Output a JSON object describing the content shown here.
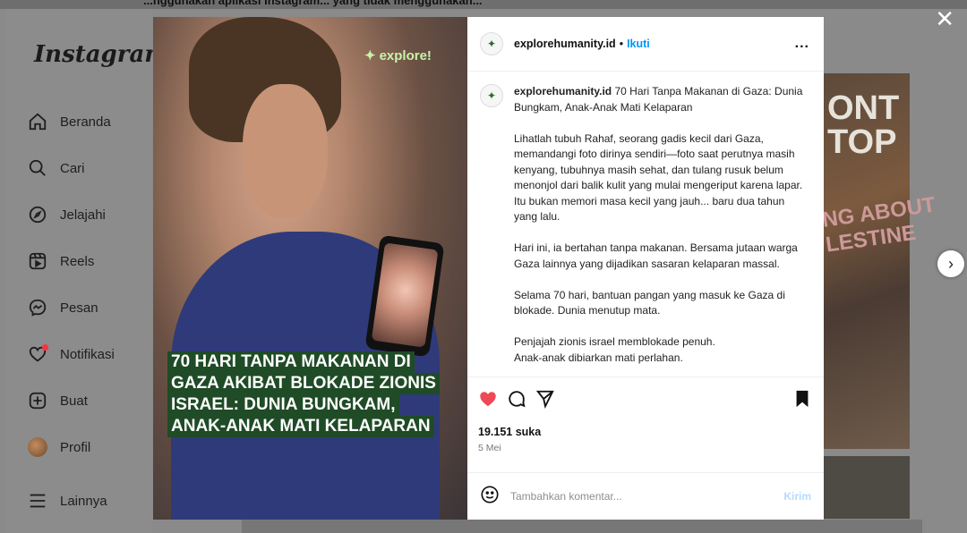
{
  "top_strip_text": "...nggunakan aplikasi Instagram... yang tidak menggunakan...",
  "sidebar": {
    "logo": "Instagram",
    "items": [
      {
        "label": "Beranda",
        "icon": "home-icon"
      },
      {
        "label": "Cari",
        "icon": "search-icon"
      },
      {
        "label": "Jelajahi",
        "icon": "compass-icon"
      },
      {
        "label": "Reels",
        "icon": "reels-icon"
      },
      {
        "label": "Pesan",
        "icon": "messenger-icon"
      },
      {
        "label": "Notifikasi",
        "icon": "heart-icon"
      },
      {
        "label": "Buat",
        "icon": "plus-square-icon"
      },
      {
        "label": "Profil",
        "icon": "profile-avatar"
      },
      {
        "label": "Lainnya",
        "icon": "menu-icon"
      }
    ]
  },
  "background_post": {
    "text_1": "ONT\nTOP",
    "text_2": "NG ABOUT\nLESTINE"
  },
  "image": {
    "brand": "explore!",
    "headline": [
      "70 HARI TANPA MAKANAN DI",
      "GAZA AKIBAT BLOKADE ZIONIS",
      "ISRAEL: DUNIA BUNGKAM,",
      "ANAK-ANAK MATI KELAPARAN"
    ]
  },
  "post": {
    "username": "explorehumanity.id",
    "separator": "•",
    "follow_label": "Ikuti",
    "more_label": "...",
    "caption_user": "explorehumanity.id",
    "caption_title": " 70 Hari Tanpa Makanan di Gaza: Dunia Bungkam, Anak-Anak Mati Kelaparan",
    "paragraphs": [
      "Lihatlah tubuh Rahaf, seorang gadis kecil dari Gaza, memandangi foto dirinya sendiri—foto saat perutnya masih kenyang, tubuhnya masih sehat, dan tulang rusuk belum menonjol dari balik kulit yang mulai mengeriput karena lapar. Itu bukan memori masa kecil yang jauh... baru dua tahun yang lalu.",
      "Hari ini, ia bertahan tanpa makanan. Bersama jutaan warga Gaza lainnya yang dijadikan sasaran kelaparan massal.",
      "Selama 70 hari, bantuan pangan yang masuk ke Gaza di blokade. Dunia menutup mata.",
      "Penjajah zionis israel memblokade penuh.\nAnak-anak dibiarkan mati perlahan."
    ],
    "likes": "19.151 suka",
    "date": "5 Mei",
    "comment_placeholder": "Tambahkan komentar...",
    "post_label": "Kirim",
    "liked": true,
    "colors": {
      "like": "#ed4956",
      "link": "#0095f6",
      "headline_bg": "#1f4b26"
    }
  },
  "close_label": "✕",
  "next_label": "›"
}
